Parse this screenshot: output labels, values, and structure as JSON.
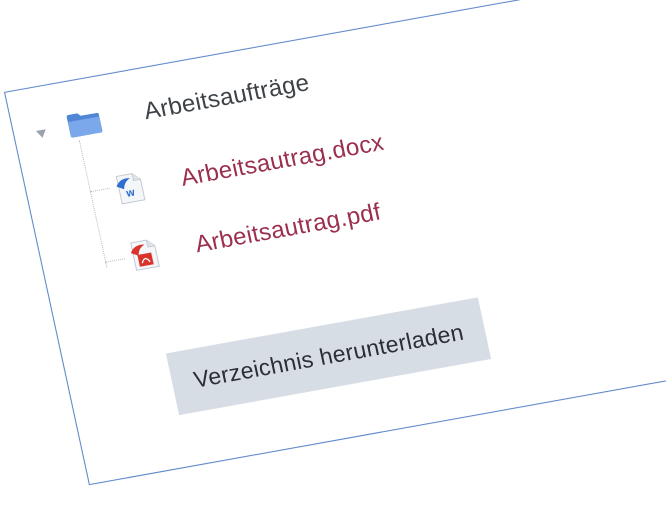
{
  "tree": {
    "folder": {
      "label": "Arbeitsaufträge",
      "icon": "folder-icon",
      "expanded": true,
      "icon_color": "#5b8fd9"
    },
    "files": [
      {
        "label": "Arbeitsautrag.docx",
        "icon": "word-document-icon",
        "icon_color": "#2e6fd1"
      },
      {
        "label": "Arbeitsautrag.pdf",
        "icon": "pdf-document-icon",
        "icon_color": "#d9332b"
      }
    ]
  },
  "actions": {
    "download_label": "Verzeichnis herunterladen"
  },
  "colors": {
    "frame_border": "#5b86c9",
    "link": "#9a2f4e",
    "button_bg": "#d7dde5"
  }
}
